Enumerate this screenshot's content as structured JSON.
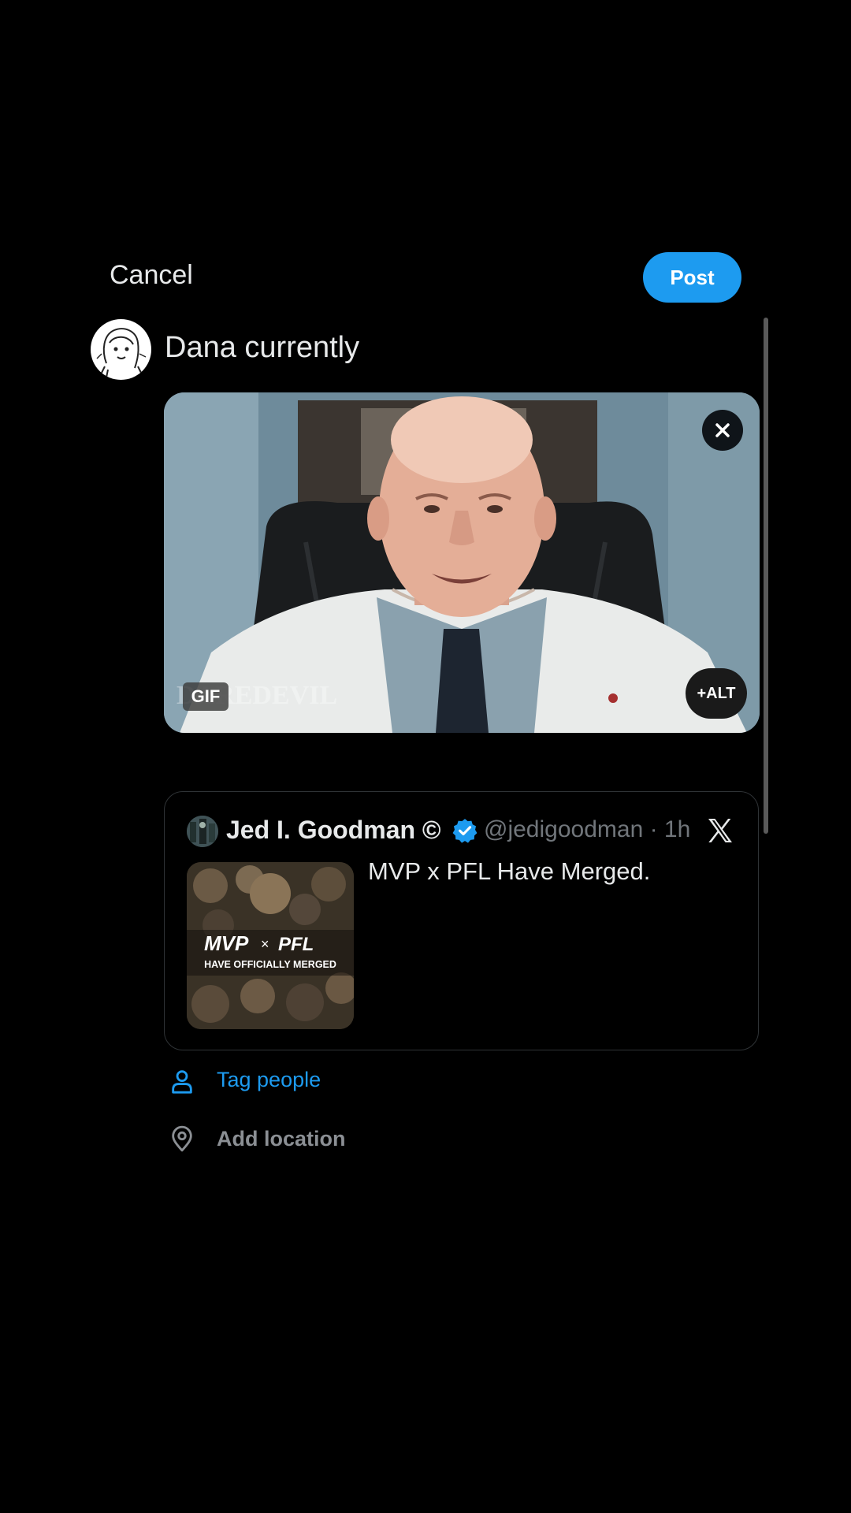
{
  "header": {
    "cancel_label": "Cancel",
    "post_label": "Post"
  },
  "composer": {
    "text": "Dana currently",
    "media": {
      "badge": "GIF",
      "alt_label": "+ALT",
      "watermark": "DAREDEVIL"
    }
  },
  "quoted_post": {
    "author_name": "Jed I. Goodman ©",
    "handle_time": "@jedigoodman · 1h",
    "text": "MVP x PFL Have Merged.",
    "thumbnail_text": {
      "brand_left": "MVP",
      "separator": "×",
      "brand_right": "PFL",
      "caption": "HAVE OFFICIALLY MERGED"
    }
  },
  "actions": {
    "tag_people": "Tag people",
    "add_location": "Add location"
  },
  "colors": {
    "accent": "#1d9bf0",
    "background": "#000000",
    "muted": "#71767b"
  },
  "icons": {
    "close": "close-icon",
    "verified": "verified-badge-icon",
    "x_logo": "x-logo-icon",
    "person": "person-icon",
    "location": "location-pin-icon"
  }
}
